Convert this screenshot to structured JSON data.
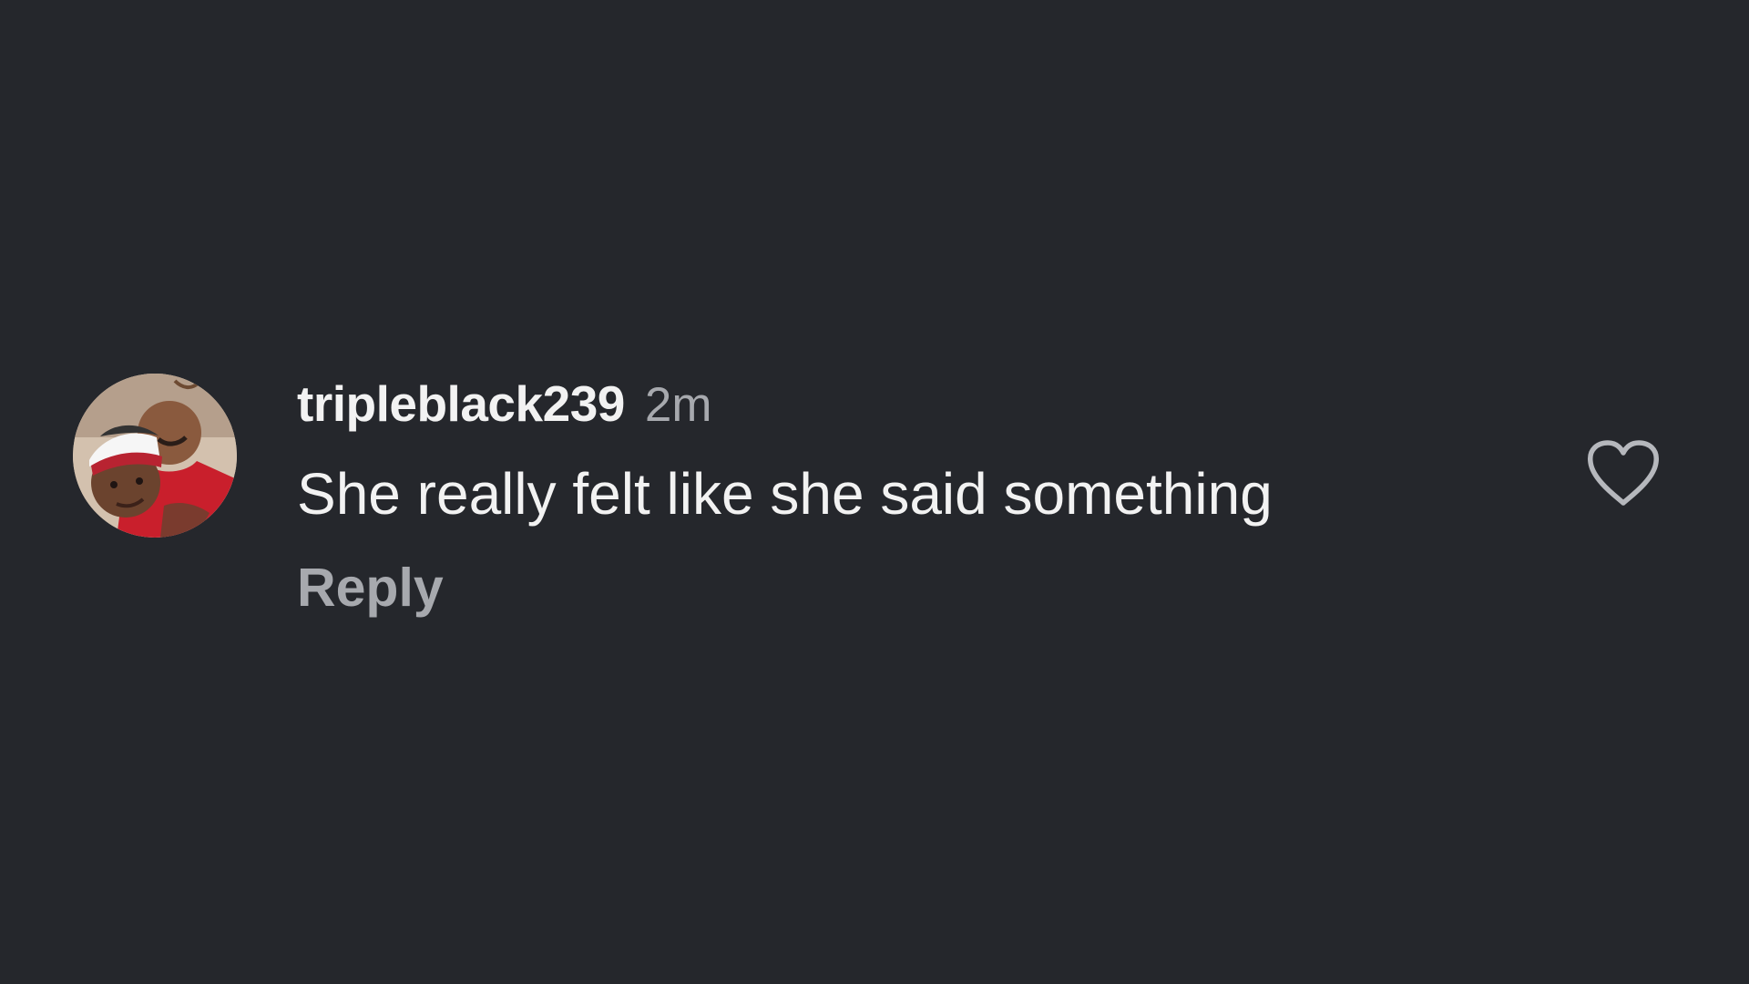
{
  "comment": {
    "avatar_icon": "user-photo-avatar",
    "username": "tripleblack239",
    "timestamp": "2m",
    "text": "She really felt like she said something",
    "reply_label": "Reply",
    "like_icon": "heart-outline-icon"
  },
  "colors": {
    "background": "#25272c",
    "primary_text": "#f2f2f2",
    "secondary_text": "#a7a9ae"
  }
}
